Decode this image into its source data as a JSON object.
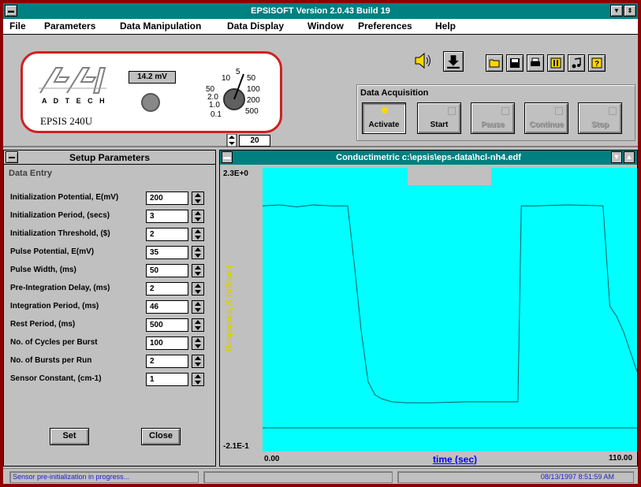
{
  "app": {
    "title": "EPSISOFT Version 2.0.43  Build 19"
  },
  "menu": [
    "File",
    "Parameters",
    "Data Manipulation",
    "Data Display",
    "Window",
    "Preferences",
    "Help"
  ],
  "device": {
    "logo_sub": "A D T E C H",
    "model": "EPSIS 240U",
    "reading": "14.2 mV",
    "dial_labels": [
      "50",
      "10",
      "5",
      "2.0",
      "1.0",
      "0.1",
      "50",
      "100",
      "200",
      "500"
    ],
    "gain": "20"
  },
  "toolbar": {
    "icons": [
      "speaker-icon",
      "download-icon",
      "open-folder-icon",
      "save-disk-icon",
      "print-icon",
      "pause-icon",
      "music-note-icon",
      "help-icon"
    ]
  },
  "acquisition": {
    "title": "Data Acquisition",
    "buttons": [
      {
        "label": "Activate",
        "state": "on"
      },
      {
        "label": "Start",
        "state": "enabled"
      },
      {
        "label": "Pause",
        "state": "disabled"
      },
      {
        "label": "Continue",
        "state": "disabled"
      },
      {
        "label": "Stop",
        "state": "disabled"
      }
    ]
  },
  "setup": {
    "title": "Setup Parameters",
    "section": "Data Entry",
    "rows": [
      {
        "label": "Initialization Potential, E(mV)",
        "value": "200"
      },
      {
        "label": "Initialization Period, (secs)",
        "value": "3"
      },
      {
        "label": "Initialization Threshold, ($)",
        "value": "2"
      },
      {
        "label": "Pulse Potential, E(mV)",
        "value": "35"
      },
      {
        "label": "Pulse Width, (ms)",
        "value": "50"
      },
      {
        "label": "Pre-Integration Delay, (ms)",
        "value": "2"
      },
      {
        "label": "Integration Period, (ms)",
        "value": "46"
      },
      {
        "label": "Rest Period, (ms)",
        "value": "500"
      },
      {
        "label": "No. of Cycles per Burst",
        "value": "100"
      },
      {
        "label": "No. of Bursts per Run",
        "value": "2"
      },
      {
        "label": "Sensor Constant, (cm-1)",
        "value": "1"
      }
    ],
    "set_label": "Set",
    "close_label": "Close"
  },
  "chart_window": {
    "title": "Conductimetric c:\\epsis\\eps-data\\hcl-nh4.edf"
  },
  "chart_data": {
    "type": "line",
    "xlabel": "time (sec)",
    "ylabel": "Response, S (uS/cm)",
    "xlim": [
      0.0,
      110.0
    ],
    "ylim": [
      -0.21,
      2.3
    ],
    "x_tick_labels": [
      "0.00",
      "110.00"
    ],
    "y_tick_labels": [
      "2.3E+0",
      "-2.1E-1"
    ],
    "background": "#00ffff",
    "line_color": "#006060",
    "series": [
      {
        "x": [
          0,
          5,
          10,
          15,
          20,
          25,
          27,
          29,
          31,
          33,
          35,
          38,
          42,
          50,
          60,
          70,
          75,
          76,
          80,
          90,
          100,
          102,
          104,
          106,
          108,
          110
        ],
        "y": [
          2.0,
          2.01,
          1.99,
          2.01,
          2.0,
          2.0,
          1.4,
          0.75,
          0.25,
          0.12,
          0.08,
          0.05,
          0.04,
          0.04,
          0.05,
          0.05,
          0.05,
          2.0,
          2.0,
          2.01,
          2.0,
          1.0,
          0.9,
          0.75,
          0.55,
          0.35
        ]
      }
    ]
  },
  "status": {
    "message": "Sensor pre-initialization in progress...",
    "datetime": "08/13/1997  8:51:59 AM"
  }
}
